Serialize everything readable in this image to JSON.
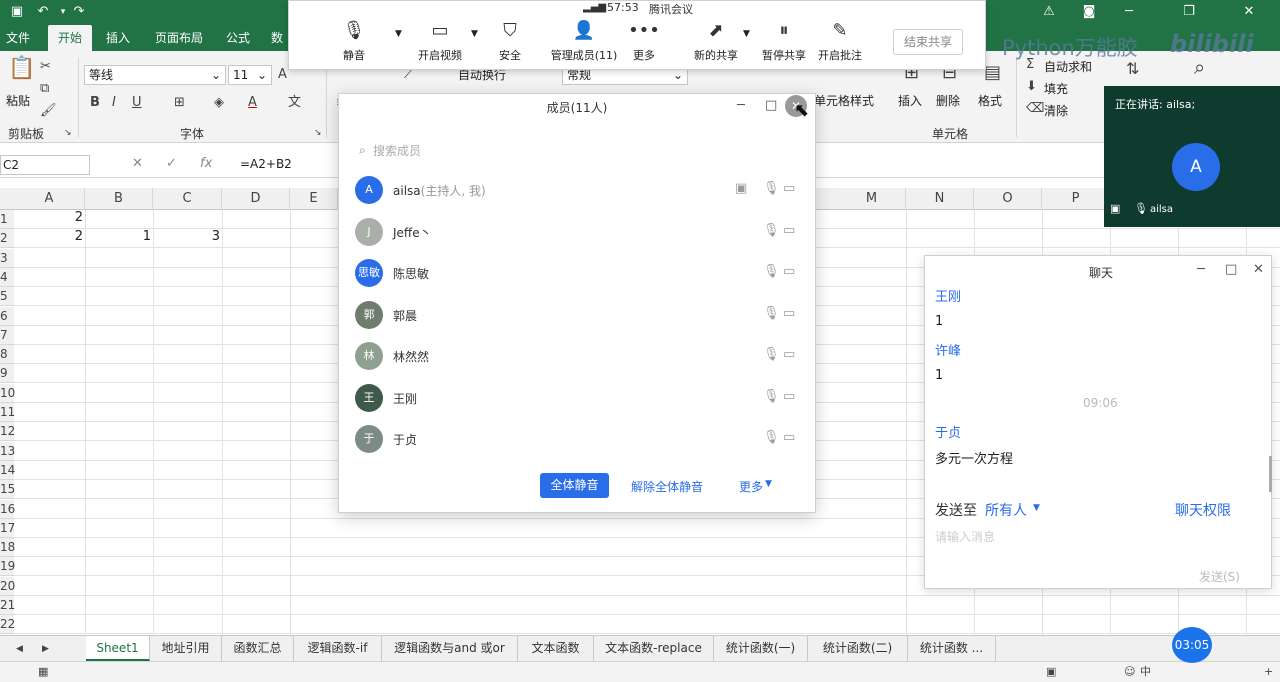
{
  "colors": {
    "excel_green": "#217346",
    "accent_blue": "#2a6de8",
    "speaker_bg": "#0f3b2e",
    "timer_blue": "#1a73e8"
  },
  "excel": {
    "tabs": [
      "文件",
      "开始",
      "插入",
      "页面布局",
      "公式",
      "数"
    ],
    "ribbon": {
      "font_name": "等线",
      "font_size": "11",
      "wrap_text": "自动换行",
      "number_format": "常规",
      "cell_style": "单元格样式",
      "insert": "插入",
      "delete": "删除",
      "format": "格式",
      "autosum": "自动求和",
      "fill": "填充",
      "clear": "清除",
      "groups": {
        "clipboard": "剪贴板",
        "font": "字体",
        "cells": "单元格"
      },
      "paste": "粘贴"
    },
    "formula_bar": {
      "name_box": "C2",
      "formula": "=A2+B2"
    },
    "columns": [
      "A",
      "B",
      "C",
      "D",
      "E",
      "M",
      "N",
      "O",
      "P"
    ],
    "rows": [
      "1",
      "2",
      "3",
      "4",
      "5",
      "6",
      "7",
      "8",
      "9",
      "10",
      "11",
      "12",
      "13",
      "14",
      "15",
      "16",
      "17",
      "18",
      "19",
      "20",
      "21",
      "22"
    ],
    "cells": {
      "A1": "2",
      "A2": "2",
      "B2": "1",
      "C2": "3"
    },
    "sheet_tabs": [
      "Sheet1",
      "地址引用",
      "函数汇总",
      "逻辑函数-if",
      "逻辑函数与and 或or",
      "文本函数",
      "文本函数-replace",
      "统计函数(一)",
      "统计函数(二)",
      "统计函数 ..."
    ]
  },
  "meeting": {
    "time": "57:53",
    "app": "腾讯会议",
    "buttons": [
      "静音",
      "开启视频",
      "安全",
      "管理成员(11)",
      "更多",
      "新的共享",
      "暂停共享",
      "开启批注"
    ],
    "end_share": "结束共享",
    "icons": [
      "microphone-icon",
      "video-icon",
      "shield-icon",
      "members-icon",
      "more-icon",
      "share-icon",
      "pause-icon",
      "annotate-icon"
    ]
  },
  "watermark": "Python万能胶",
  "watermark_logo": "bilibili",
  "members": {
    "title": "成员(11人)",
    "search_placeholder": "搜索成员",
    "list": [
      {
        "name": "ailsa",
        "role": "(主持人, 我)",
        "avatar": "A",
        "avatar_color": "#2a6de8"
      },
      {
        "name": "Jeffe丶",
        "role": "",
        "avatar": "J",
        "avatar_color": "#a8b0a8"
      },
      {
        "name": "陈思敏",
        "role": "",
        "avatar": "思敏",
        "avatar_color": "#2a6de8"
      },
      {
        "name": "郭晨",
        "role": "",
        "avatar": "郭",
        "avatar_color": "#6f7d6f"
      },
      {
        "name": "林然然",
        "role": "",
        "avatar": "林",
        "avatar_color": "#8fa090"
      },
      {
        "name": "王刚",
        "role": "",
        "avatar": "王",
        "avatar_color": "#3f5a4a"
      },
      {
        "name": "于贞",
        "role": "",
        "avatar": "于",
        "avatar_color": "#7d8a86"
      }
    ],
    "mute_all": "全体静音",
    "unmute_all": "解除全体静音",
    "more": "更多"
  },
  "speaker": {
    "label": "正在讲话: ailsa;",
    "avatar": "A",
    "name": "ailsa"
  },
  "chat": {
    "title": "聊天",
    "messages": [
      {
        "sender": "王刚",
        "text": "1"
      },
      {
        "sender": "许峰",
        "text": "1"
      },
      {
        "sender": "于贞",
        "text": "多元一次方程"
      }
    ],
    "timestamp": "09:06",
    "send_to_label": "发送至",
    "send_to_value": "所有人",
    "permissions": "聊天权限",
    "input_placeholder": "请输入消息",
    "send": "发送(S)"
  },
  "timer": "03:05",
  "taskbar": {
    "ime": "中"
  }
}
